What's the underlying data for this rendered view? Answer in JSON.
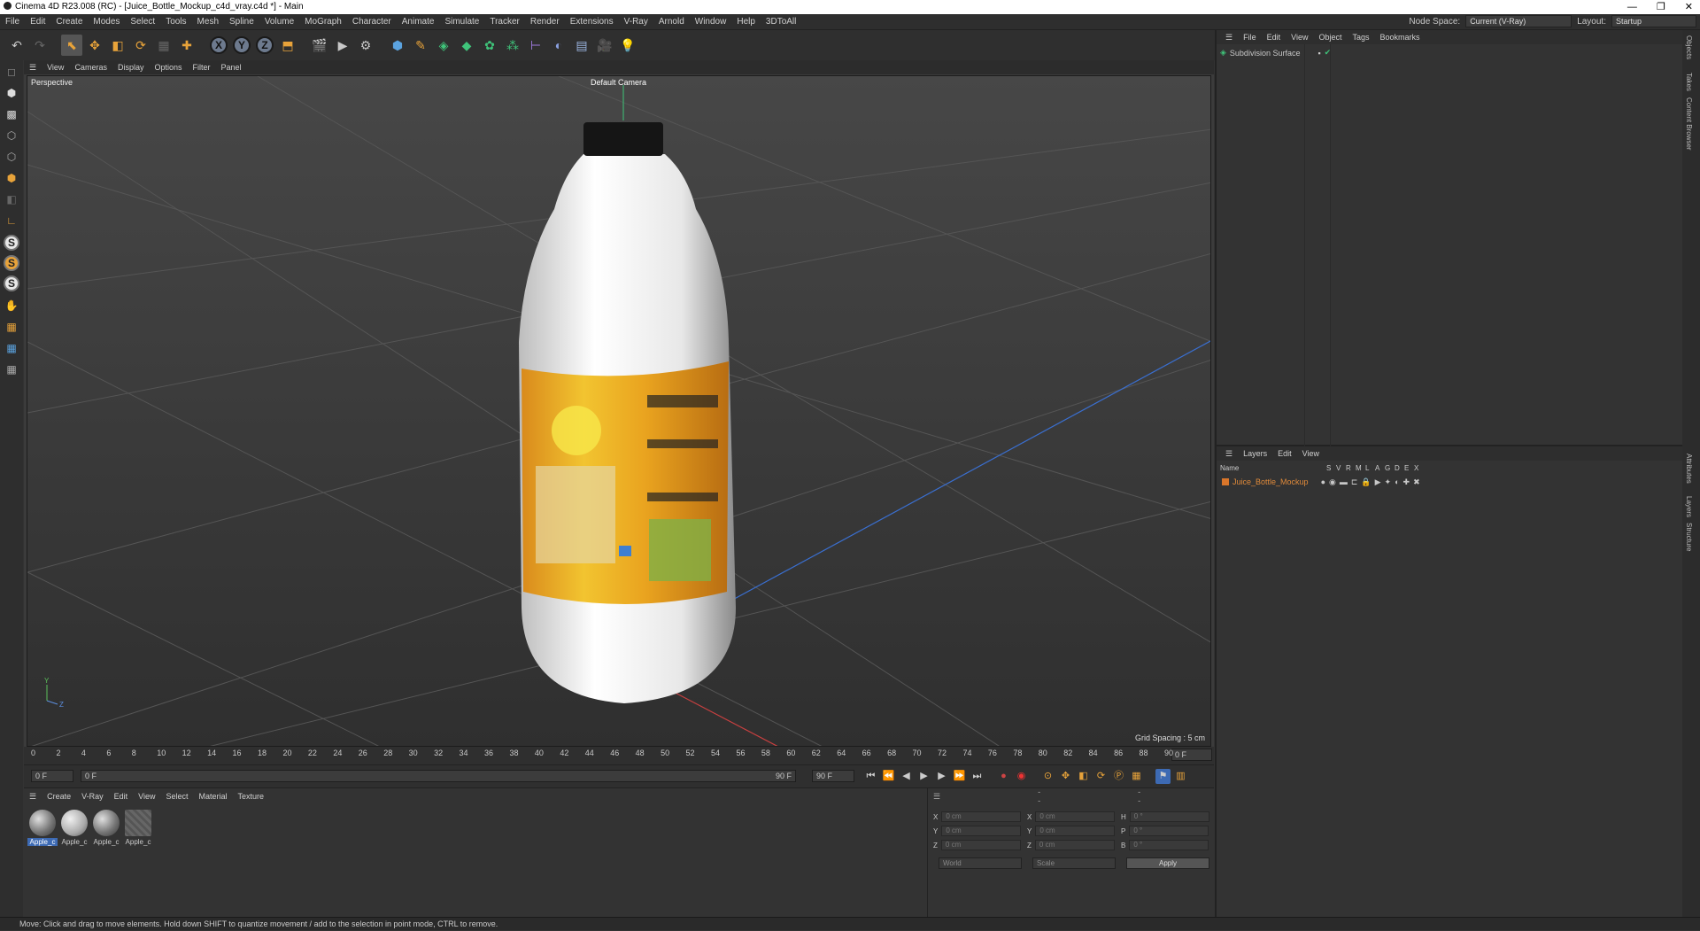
{
  "window": {
    "title": "Cinema 4D R23.008 (RC) - [Juice_Bottle_Mockup_c4d_vray.c4d *] - Main",
    "controls": [
      "—",
      "❐",
      "✕"
    ]
  },
  "menubar": {
    "items": [
      "File",
      "Edit",
      "Create",
      "Modes",
      "Select",
      "Tools",
      "Mesh",
      "Spline",
      "Volume",
      "MoGraph",
      "Character",
      "Animate",
      "Simulate",
      "Tracker",
      "Render",
      "Extensions",
      "V-Ray",
      "Arnold",
      "Window",
      "Help",
      "3DToAll"
    ],
    "node_space_label": "Node Space:",
    "node_space_value": "Current (V-Ray)",
    "layout_label": "Layout:",
    "layout_value": "Startup"
  },
  "viewport": {
    "menu": [
      "View",
      "Cameras",
      "Display",
      "Options",
      "Filter",
      "Panel"
    ],
    "label": "Perspective",
    "camera": "Default Camera",
    "grid_spacing": "Grid Spacing : 5 cm"
  },
  "timeline": {
    "ticks": [
      "0",
      "2",
      "4",
      "6",
      "8",
      "10",
      "12",
      "14",
      "16",
      "18",
      "20",
      "22",
      "24",
      "26",
      "28",
      "30",
      "32",
      "34",
      "36",
      "38",
      "40",
      "42",
      "44",
      "46",
      "48",
      "50",
      "52",
      "54",
      "56",
      "58",
      "60",
      "62",
      "64",
      "66",
      "68",
      "70",
      "72",
      "74",
      "76",
      "78",
      "80",
      "82",
      "84",
      "86",
      "88",
      "90"
    ],
    "current_frame": "0 F"
  },
  "transport": {
    "start": "0 F",
    "range_start": "0 F",
    "range_end": "90 F",
    "end": "90 F"
  },
  "material_manager": {
    "menu": [
      "Create",
      "V-Ray",
      "Edit",
      "View",
      "Select",
      "Material",
      "Texture"
    ],
    "materials": [
      {
        "name": "Apple_c",
        "style": "ball"
      },
      {
        "name": "Apple_c",
        "style": "plain"
      },
      {
        "name": "Apple_c",
        "style": "ball"
      },
      {
        "name": "Apple_c",
        "style": "striped"
      }
    ]
  },
  "coordinates": {
    "headers": [
      "--",
      "--",
      "--"
    ],
    "rows": [
      {
        "a": "X",
        "av": "0 cm",
        "b": "X",
        "bv": "0 cm",
        "c": "H",
        "cv": "0 °"
      },
      {
        "a": "Y",
        "av": "0 cm",
        "b": "Y",
        "bv": "0 cm",
        "c": "P",
        "cv": "0 °"
      },
      {
        "a": "Z",
        "av": "0 cm",
        "b": "Z",
        "bv": "0 cm",
        "c": "B",
        "cv": "0 °"
      }
    ],
    "mode": "World",
    "size_mode": "Scale",
    "apply": "Apply"
  },
  "objects_panel": {
    "menu": [
      "File",
      "Edit",
      "View",
      "Object",
      "Tags",
      "Bookmarks"
    ],
    "object": "Subdivision Surface"
  },
  "layers_panel": {
    "menu": [
      "Layers",
      "Edit",
      "View"
    ],
    "columns": [
      "Name",
      "S",
      "V",
      "R",
      "M",
      "L",
      "A",
      "G",
      "D",
      "E",
      "X"
    ],
    "layer": "Juice_Bottle_Mockup",
    "layer_color": "#d9762a"
  },
  "side_tabs": [
    "Objects",
    "Takes",
    "Content Browser",
    "Attributes",
    "Layers",
    "Structure"
  ],
  "status": "Move: Click and drag to move elements. Hold down SHIFT to quantize movement / add to the selection in point mode, CTRL to remove."
}
